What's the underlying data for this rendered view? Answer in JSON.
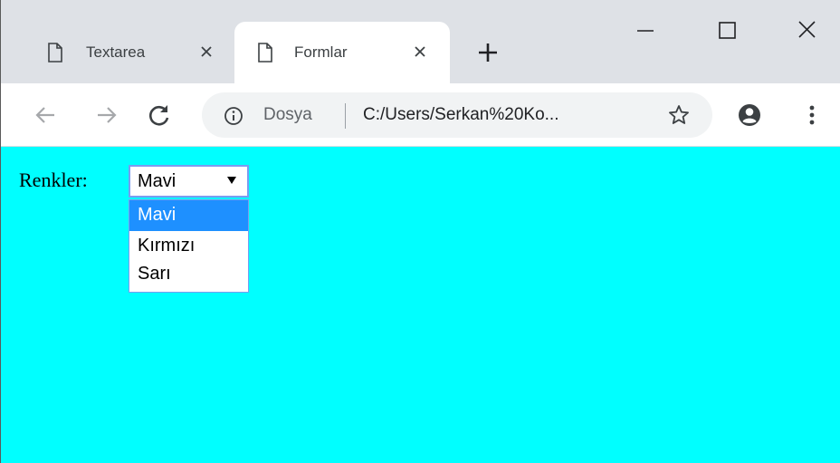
{
  "browser": {
    "tabs": [
      {
        "title": "Textarea",
        "active": false
      },
      {
        "title": "Formlar",
        "active": true
      }
    ],
    "address": {
      "scheme_label": "Dosya",
      "url": "C:/Users/Serkan%20Ko..."
    },
    "icons": {
      "tab_page": "document-icon",
      "tab_close": "close-icon",
      "new_tab": "plus-icon",
      "minimize": "minimize-icon",
      "maximize": "maximize-icon",
      "close_window": "close-icon",
      "back": "arrow-left-icon",
      "forward": "arrow-right-icon",
      "reload": "reload-icon",
      "info": "info-icon",
      "bookmark": "star-icon",
      "account": "account-icon",
      "menu": "vertical-dots-icon"
    }
  },
  "page": {
    "background": "#00ffff",
    "label": "Renkler:",
    "select": {
      "value": "Mavi",
      "options": [
        "Mavi",
        "Kırmızı",
        "Sarı"
      ],
      "highlighted": "Mavi",
      "highlight_color": "#1e90ff"
    }
  }
}
